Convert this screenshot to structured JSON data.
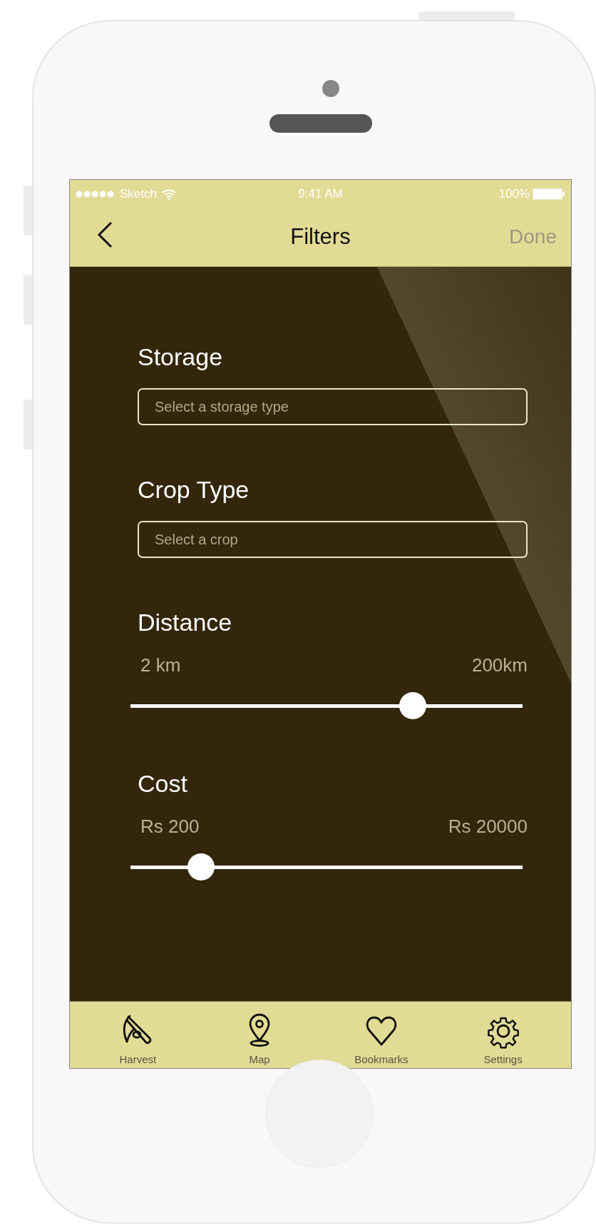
{
  "status_bar": {
    "carrier": "Sketch",
    "time": "9:41 AM",
    "battery": "100%"
  },
  "nav_bar": {
    "title": "Filters",
    "action": "Done"
  },
  "filters": [
    {
      "kind": "select",
      "label": "Storage",
      "placeholder": "Select a storage type"
    },
    {
      "kind": "select",
      "label": "Crop Type",
      "placeholder": "Select a crop"
    },
    {
      "kind": "range",
      "label": "Distance",
      "min_label": "2 km",
      "max_label": "200km",
      "level": 0.72
    },
    {
      "kind": "range",
      "label": "Cost",
      "min_label": "Rs 200",
      "max_label": "Rs 20000",
      "level": 0.18
    }
  ],
  "tab_bar": [
    {
      "label": "Harvest"
    },
    {
      "label": "Map"
    },
    {
      "label": "Bookmarks"
    },
    {
      "label": "Settings"
    }
  ]
}
